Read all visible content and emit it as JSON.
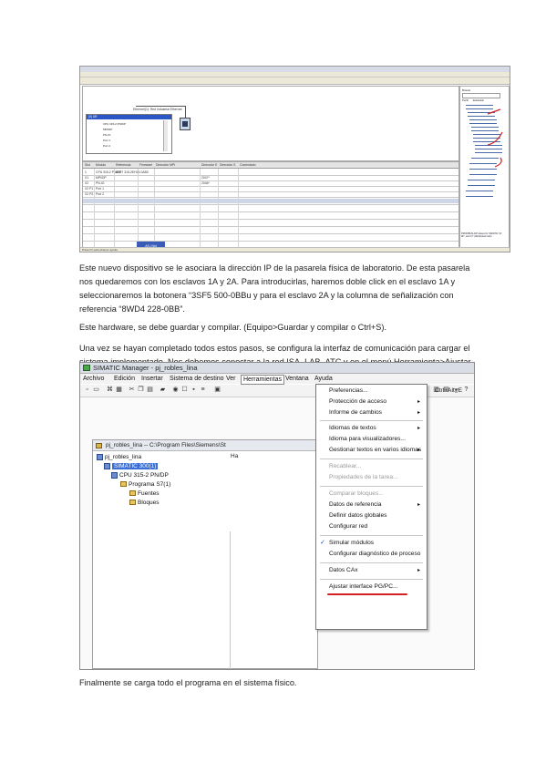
{
  "paragraphs": [
    "Este nuevo dispositivo se le asociara la dirección IP de la pasarela física de laboratorio. De esta pasarela nos quedaremos con los esclavos 1A y 2A. Para introducirlas, haremos doble click en el esclavo 1A y seleccionaremos la botonera “3SF5 500-0BBu y para el esclavo 2A y la columna de señalización con referencia “8WD4 228-0BB”.",
    "Este hardware, se debe guardar y compilar. (Equipo>Guardar y compilar o Ctrl+S).",
    "Una vez se hayan completado todos estos pasos, se configura la interfaz de comunicación para cargar el sistema implementado. Nos debemos conectar a la red ISA_LAB_ATC y en el menú Herramienta>Ajustar interface PG/PC, escogeremos TCP/IP.",
    "Finalmente se carga todo el programa en el sistema físico."
  ],
  "colors": {
    "selection": "#3a6fd8",
    "menu_highlight": "#d42020",
    "title_bar": "#d9dde5",
    "annotation_red": "#d42020"
  },
  "shot2": {
    "title": "SIMATIC Manager - pj_robles_lina",
    "menu": [
      "Archivo",
      "Edición",
      "Insertar",
      "Sistema de destino",
      "Ver",
      "Herramientas",
      "Ventana",
      "Ayuda"
    ],
    "project_window_title": "pj_robles_lina -- C:\\Program Files\\Siemens\\St",
    "tree": [
      {
        "label": "pj_robles_lina",
        "kind": "project"
      },
      {
        "label": "SIMATIC 300(1)",
        "kind": "station",
        "selected": true
      },
      {
        "label": "CPU 315-2 PN/DP",
        "kind": "cpu"
      },
      {
        "label": "Programa S7(1)",
        "kind": "folder"
      },
      {
        "label": "Fuentes",
        "kind": "folder"
      },
      {
        "label": "Bloques",
        "kind": "folder"
      }
    ],
    "right_pane_label": "Ha",
    "dropdown": [
      {
        "label": "Preferencias...",
        "shortcut": "Ctrl+Alt+E"
      },
      {
        "label": "Protección de acceso",
        "submenu": true
      },
      {
        "label": "Informe de cambios",
        "submenu": true
      },
      {
        "sep": true
      },
      {
        "label": "Idiomas de textos",
        "submenu": true
      },
      {
        "label": "Idioma para visualizadores..."
      },
      {
        "label": "Gestionar textos en varios idiomas",
        "submenu": true
      },
      {
        "sep": true
      },
      {
        "label": "Recablear...",
        "disabled": true
      },
      {
        "label": "Propiedades de la tarea...",
        "disabled": true
      },
      {
        "sep": true
      },
      {
        "label": "Comparar bloques...",
        "disabled": true
      },
      {
        "label": "Datos de referencia",
        "submenu": true
      },
      {
        "label": "Definir datos globales"
      },
      {
        "label": "Configurar red"
      },
      {
        "sep": true
      },
      {
        "label": "Simular módulos",
        "checked": true
      },
      {
        "label": "Configurar diagnóstico de proceso"
      },
      {
        "sep": true
      },
      {
        "label": "Datos CAx",
        "submenu": true
      },
      {
        "sep": true
      },
      {
        "label": "Ajustar interface PG/PC..."
      }
    ]
  },
  "shot1": {
    "catalog_search_label": "Buscar",
    "catalog_profile_label": "Perfil",
    "catalog_profile_value": "Estándar",
    "catalog_footer": "PROFIBUS-DP slaves for SIMATIC S7, M7, and C7 (distributed rack)",
    "rack_label": "Ethernet(1): Red Industrial Ethernet",
    "mini_window_title": "(0) UR",
    "mini_rows": [
      "CPU 315-2 PN/DP",
      "MPI/DP",
      "PN-IO",
      "Port 1",
      "Port 2"
    ],
    "detail_header": [
      "Slot",
      "Módulo",
      "Referencia",
      "Firmware",
      "Dirección MPI",
      "Dirección E",
      "Dirección S",
      "Comentario"
    ],
    "detail_rows": [
      [
        "1",
        "CPU 315-2 PN/DP",
        "6ES7 315-2EH14-0AB0",
        "V3.2",
        "2",
        "",
        "",
        ""
      ],
      [
        "X1",
        "MPI/DP",
        "",
        "",
        "2",
        "2047*",
        "",
        ""
      ],
      [
        "X2",
        "PN-IO",
        "",
        "",
        "",
        "2046*",
        "",
        ""
      ],
      [
        "X2 P1",
        "Port 1",
        "",
        "",
        "",
        "2045*",
        "",
        ""
      ],
      [
        "X2 P2",
        "Port 2",
        "",
        "",
        "",
        "2044*",
        "",
        ""
      ]
    ],
    "taskbar_label": "AS-i Net",
    "status_text": "Pulse F1 para obtener ayuda."
  }
}
